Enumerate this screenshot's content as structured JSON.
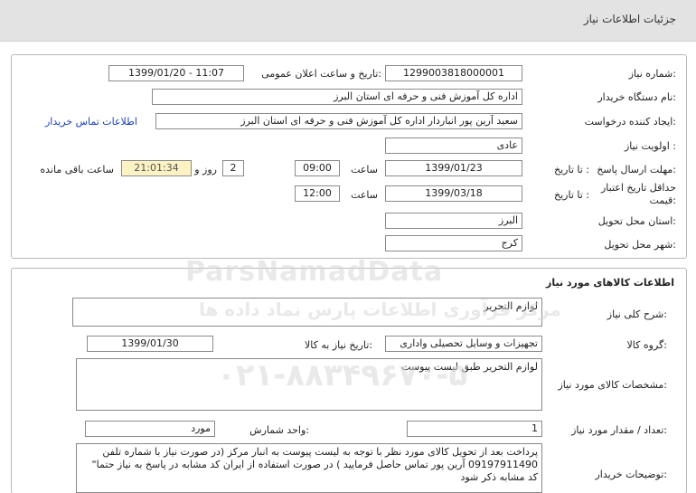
{
  "header": {
    "title": "جزئیات اطلاعات نیاز"
  },
  "info": {
    "need_number_label": "شماره نیاز:",
    "need_number": "1299003818000001",
    "announce_label": "تاریخ و ساعت اعلان عمومی:",
    "announce_value": "1399/01/20 - 11:07",
    "buyer_org_label": "نام دستگاه خریدار:",
    "buyer_org": "اداره کل آموزش فنی و حرفه ای استان البرز",
    "creator_label": "ایجاد کننده درخواست:",
    "creator": "سعید آرین پور انباردار اداره کل آموزش فنی و حرفه ای استان البرز",
    "contact_link": "اطلاعات تماس خریدار",
    "priority_label": "اولویت نیاز :",
    "priority": "عادی",
    "deadline_label": "مهلت ارسال پاسخ:",
    "until_date_label": "تا تاریخ :",
    "deadline_date": "1399/01/23",
    "time_label": "ساعت",
    "deadline_time": "09:00",
    "days_value": "2",
    "days_label": "روز و",
    "remaining_time": "21:01:34",
    "remaining_label": "ساعت باقی مانده",
    "validity_label": "حداقل تاریخ اعتبار قیمت:",
    "validity_until_label": "تا تاریخ :",
    "validity_date": "1399/03/18",
    "validity_time_label": "ساعت",
    "validity_time": "12:00",
    "province_label": "استان محل تحویل:",
    "province": "البرز",
    "city_label": "شهر محل تحویل:",
    "city": "کرج"
  },
  "goods": {
    "section_title": "اطلاعات کالاهای مورد نیاز",
    "summary_label": "شرح کلی نیاز:",
    "summary": "لوازم التحریر",
    "group_label": "گروه کالا:",
    "group": "تجهیزات و وسایل تحصیلی واداری",
    "need_date_label": "تاریخ نیاز به کالا:",
    "need_date": "1399/01/30",
    "specs_label": "مشخصات کالای مورد نیاز:",
    "specs": "لوازم التحریر طبق لیست پیوست",
    "qty_label": "تعداد / مقدار مورد نیاز:",
    "qty": "1",
    "unit_label": "واحد شمارش:",
    "unit": "مورد",
    "notes_label": "توضیحات خریدار:",
    "notes": "پرداخت بعد از تحویل کالای مورد نظر با توجه به لیست پیوست به انبار مرکز (در صورت نیاز با شماره تلفن 09197911490 آرین پور تماس حاصل فرمایید ) در صورت استفاده از ایران کد مشابه در پاسخ به نیاز حتما\" کد مشابه ذکر شود"
  },
  "watermark": {
    "brand": "ParsNamadData",
    "persian_line": "مرکز فرآوری اطلاعات پارس نماد داده ها",
    "phone": "۰۲۱-۸۸۳۴۹۶۷۰-۵"
  }
}
